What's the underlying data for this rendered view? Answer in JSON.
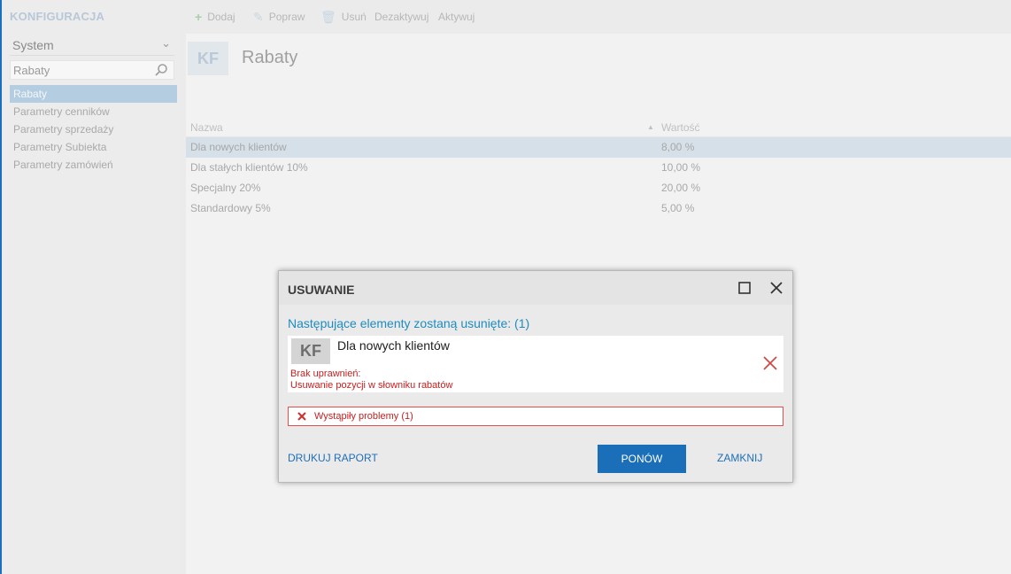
{
  "sidebar": {
    "title": "KONFIGURACJA",
    "selector": "System",
    "search_value": "Rabaty",
    "items": [
      {
        "label": "Rabaty",
        "active": true
      },
      {
        "label": "Parametry cenników"
      },
      {
        "label": "Parametry sprzedaży"
      },
      {
        "label": "Parametry Subiekta"
      },
      {
        "label": "Parametry zamówień"
      }
    ]
  },
  "toolbar": {
    "add": "Dodaj",
    "edit": "Popraw",
    "delete": "Usuń",
    "deactivate": "Dezaktywuj",
    "activate": "Aktywuj"
  },
  "page": {
    "badge": "KF",
    "title": "Rabaty"
  },
  "grid": {
    "columns": [
      "Nazwa",
      "Wartość"
    ],
    "rows": [
      {
        "name": "Dla nowych klientów",
        "value": "8,00 %"
      },
      {
        "name": "Dla stałych klientów 10%",
        "value": "10,00 %"
      },
      {
        "name": "Specjalny 20%",
        "value": "20,00 %"
      },
      {
        "name": "Standardowy 5%",
        "value": "5,00 %"
      }
    ]
  },
  "dialog": {
    "title": "USUWANIE",
    "subtitle": "Następujące elementy zostaną usunięte: (1)",
    "item": {
      "badge": "KF",
      "name": "Dla nowych klientów",
      "error_title": "Brak uprawnień:",
      "error_detail": "Usuwanie pozycji w słowniku rabatów"
    },
    "problems": "Wystąpiły problemy (1)",
    "print_report": "DRUKUJ RAPORT",
    "retry": "PONÓW",
    "close": "ZAMKNIJ"
  },
  "colors": {
    "accent": "#1a6fb8",
    "error": "#c81e1e",
    "link": "#1e8cc0"
  }
}
